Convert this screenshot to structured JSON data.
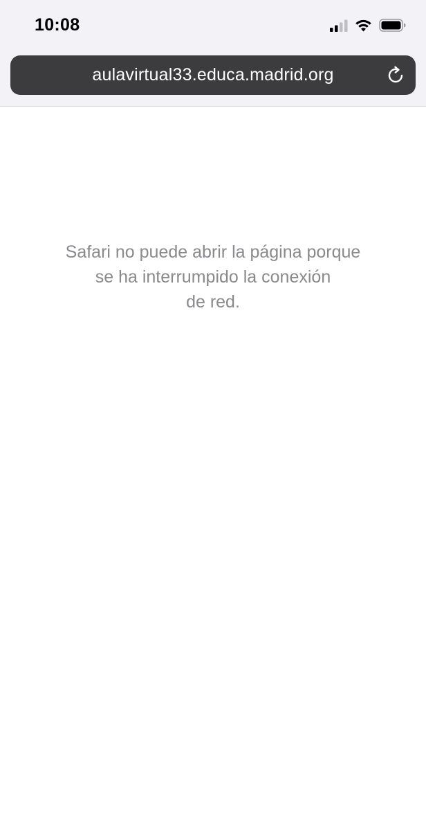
{
  "status_bar": {
    "time": "10:08",
    "icons": [
      "cellular-signal-icon",
      "wifi-icon",
      "battery-icon"
    ]
  },
  "address_bar": {
    "url": "aulavirtual33.educa.madrid.org",
    "reload_icon": "reload-icon"
  },
  "page": {
    "error_message": "Safari no puede abrir la página porque\nse ha interrumpido la conexión\nde red."
  },
  "colors": {
    "chrome_background": "#f2f2f7",
    "address_bar_background": "#3c3c3e",
    "url_text": "#ffffff",
    "error_text": "#8a8a8e"
  }
}
